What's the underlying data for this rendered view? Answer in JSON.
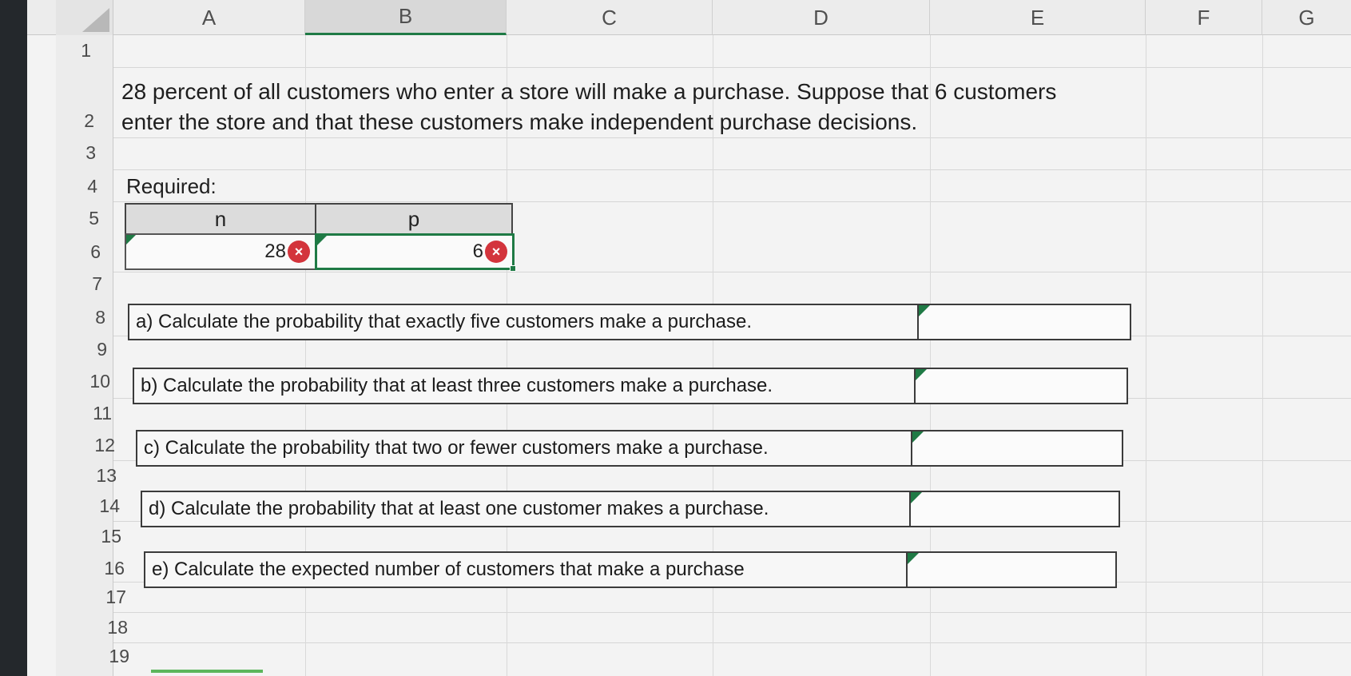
{
  "columns": [
    "A",
    "B",
    "C",
    "D",
    "E",
    "F",
    "G"
  ],
  "rows": [
    "1",
    "2",
    "3",
    "4",
    "5",
    "6",
    "7",
    "8",
    "9",
    "10",
    "11",
    "12",
    "13",
    "14",
    "15",
    "16",
    "17",
    "18",
    "19"
  ],
  "problem": {
    "line1": "28 percent of all customers who enter a store will make a purchase. Suppose that 6 customers",
    "line2": "enter the store and that these customers make independent purchase decisions."
  },
  "required_label": "Required:",
  "input_table": {
    "n_label": "n",
    "p_label": "p",
    "n_value": "28",
    "p_value": "6"
  },
  "questions": [
    "a) Calculate the probability that exactly five customers make a purchase.",
    "b) Calculate the probability that at least three customers make a purchase.",
    "c) Calculate the probability that two or fewer customers make a purchase.",
    "d) Calculate the probability that at least one customer makes a purchase.",
    "e) Calculate the expected number of customers that make a purchase"
  ],
  "icons": {
    "error": "error-x-icon",
    "error_glyph": "×"
  },
  "colors": {
    "accent": "#1f7a45",
    "error": "#d3343c"
  }
}
